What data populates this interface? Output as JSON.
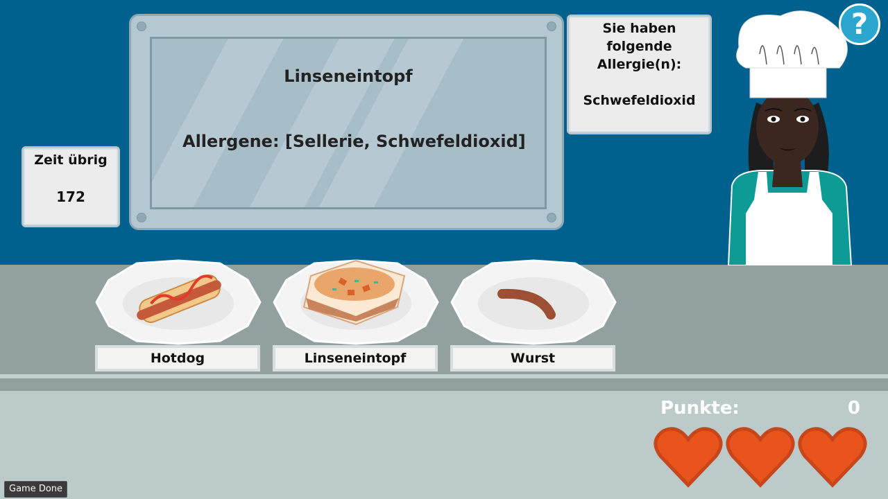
{
  "timer": {
    "label": "Zeit übrig",
    "value": "172"
  },
  "menu_board": {
    "dish": "Linseneintopf",
    "allergens": "Allergene: [Sellerie, Schwefeldioxid]"
  },
  "allergy_info": {
    "heading": "Sie haben folgende Allergie(n):",
    "allergy": "Schwefeldioxid"
  },
  "help": {
    "symbol": "?"
  },
  "dishes": [
    {
      "name": "Hotdog",
      "icon": "hotdog-icon"
    },
    {
      "name": "Linseneintopf",
      "icon": "stew-bowl-icon"
    },
    {
      "name": "Wurst",
      "icon": "sausage-icon"
    }
  ],
  "score": {
    "label": "Punkte:",
    "value": "0"
  },
  "lives": {
    "count": 3,
    "max": 3,
    "color": "#e8541c"
  },
  "debug_button": "Game Done",
  "colors": {
    "wall": "#00618f",
    "counter": "#93a0a0",
    "floor": "#bccaca",
    "help": "#2aa6cf"
  }
}
